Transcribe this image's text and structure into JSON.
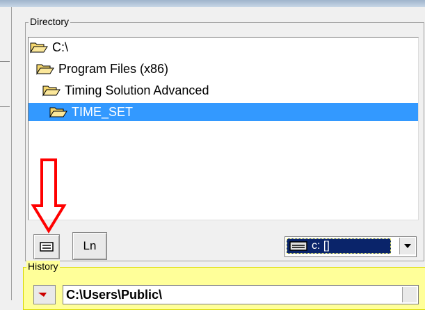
{
  "directory": {
    "title": "Directory",
    "tree": [
      {
        "label": "C:\\",
        "state": "open",
        "selected": false
      },
      {
        "label": "Program Files (x86)",
        "state": "open",
        "selected": false
      },
      {
        "label": "Timing Solution Advanced",
        "state": "open",
        "selected": false
      },
      {
        "label": "TIME_SET",
        "state": "open",
        "selected": true
      }
    ],
    "list_button_icon": "list-icon",
    "ln_button_label": "Ln",
    "drive": {
      "value": "c: []",
      "icon": "drive-icon"
    }
  },
  "history": {
    "title": "History",
    "value": "C:\\Users\\Public\\"
  },
  "annotation": {
    "icon": "red-down-arrow",
    "color": "#ff0000"
  },
  "colors": {
    "selection": "#3399ff",
    "history_bg": "#ffff99",
    "folder_fill": "#f5d76e",
    "drive_selection": "#0a246a"
  }
}
